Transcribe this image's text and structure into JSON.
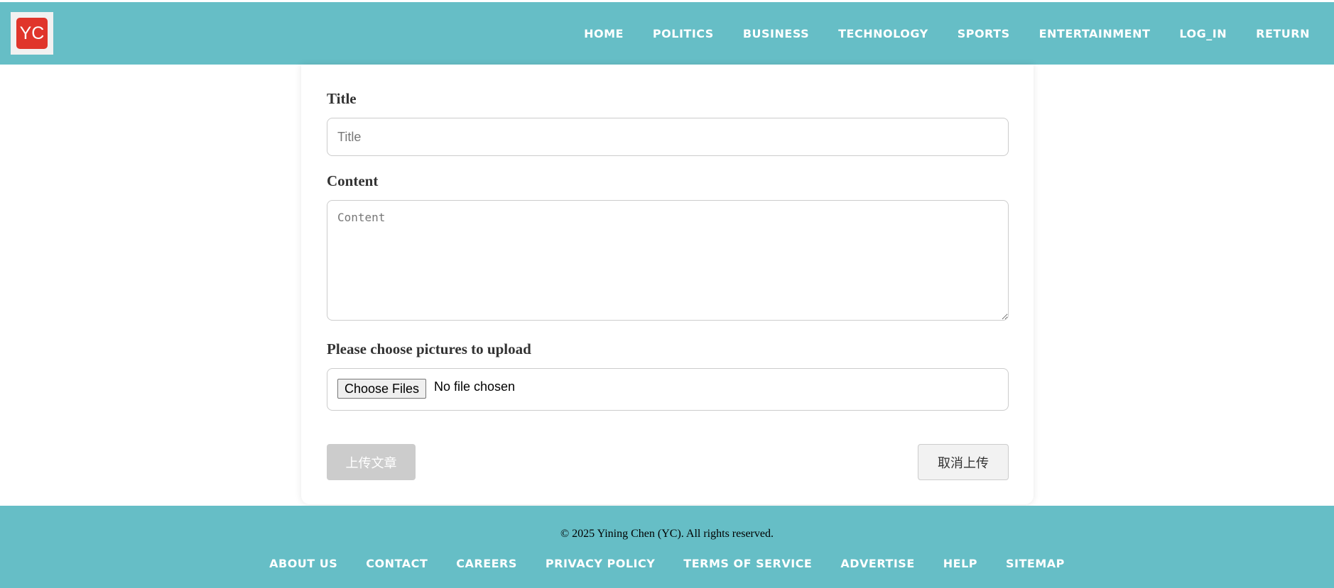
{
  "header": {
    "logo_text": "YC",
    "nav": [
      "HOME",
      "POLITICS",
      "BUSINESS",
      "TECHNOLOGY",
      "SPORTS",
      "ENTERTAINMENT",
      "LOG_IN",
      "RETURN"
    ]
  },
  "form": {
    "title_label": "Title",
    "title_placeholder": "Title",
    "title_value": "",
    "content_label": "Content",
    "content_placeholder": "Content",
    "content_value": "",
    "pictures_label": "Please choose pictures to upload",
    "choose_files_label": "Choose Files",
    "file_status": "No file chosen",
    "upload_button": "上传文章",
    "cancel_button": "取消上传"
  },
  "footer": {
    "copyright": "© 2025 Yining Chen (YC). All rights reserved.",
    "links": [
      "ABOUT US",
      "CONTACT",
      "CAREERS",
      "PRIVACY POLICY",
      "TERMS OF SERVICE",
      "ADVERTISE",
      "HELP",
      "SITEMAP"
    ]
  },
  "colors": {
    "header_bg": "#66bec6",
    "logo_red": "#e0352b",
    "disabled_button": "#cccccc"
  }
}
